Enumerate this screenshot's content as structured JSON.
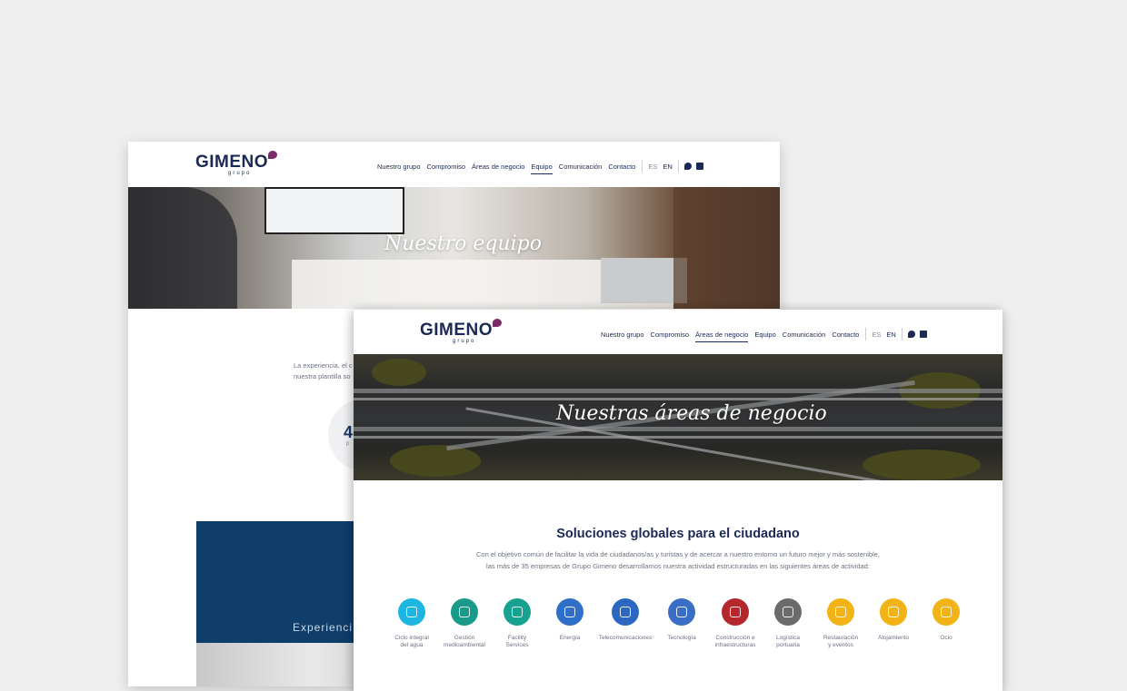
{
  "brand": {
    "logo_text": "GIMENO",
    "logo_sub": "grupo",
    "accent": "#1b2a55",
    "mark_color": "#7d2a6a"
  },
  "back_window": {
    "nav": [
      "Nuestro grupo",
      "Compromiso",
      "Áreas de negocio",
      "Equipo",
      "Comunicación",
      "Contacto"
    ],
    "active": "Equipo",
    "lang": [
      "ES",
      "EN"
    ],
    "hero_title": "Nuestro equipo",
    "text_line1": "La experiencia, el c",
    "text_line2": "nuestra plantilla so",
    "stat": "4",
    "stat_sub": "p",
    "block_label": "Experienci"
  },
  "front_window": {
    "nav": [
      "Nuestro grupo",
      "Compromiso",
      "Áreas de negocio",
      "Equipo",
      "Comunicación",
      "Contacto"
    ],
    "active": "Áreas de negocio",
    "lang": [
      "ES",
      "EN"
    ],
    "hero_title": "Nuestras áreas de negocio",
    "section_title": "Soluciones globales para el ciudadano",
    "desc_line1": "Con el objetivo común de facilitar la vida de ciudadanos/as y turistas y de acercar a nuestro entorno un futuro mejor y más sostenible,",
    "desc_line2": "las más de 35 empresas de Grupo Gimeno desarrollamos nuestra actividad estructuradas en las siguientes áreas de actividad:",
    "areas": [
      {
        "label1": "Ciclo integral",
        "label2": "del agua",
        "color": "#1cb6e0",
        "icon": "water-drop-icon"
      },
      {
        "label1": "Gestión",
        "label2": "medioambiental",
        "color": "#1a9b8a",
        "icon": "environment-icon"
      },
      {
        "label1": "Facility",
        "label2": "Services",
        "color": "#17a191",
        "icon": "facility-icon"
      },
      {
        "label1": "Energía",
        "label2": "",
        "color": "#2f6fc7",
        "icon": "energy-icon"
      },
      {
        "label1": "Telecomunicaciones",
        "label2": "",
        "color": "#2c68c0",
        "icon": "antenna-icon"
      },
      {
        "label1": "Tecnología",
        "label2": "",
        "color": "#3a6ec4",
        "icon": "technology-icon"
      },
      {
        "label1": "Construcción e",
        "label2": "infraestructuras",
        "color": "#b3272d",
        "icon": "crane-icon"
      },
      {
        "label1": "Logística",
        "label2": "portuaria",
        "color": "#6b6b6b",
        "icon": "port-icon"
      },
      {
        "label1": "Restauración",
        "label2": "y eventos",
        "color": "#f2b316",
        "icon": "restaurant-icon"
      },
      {
        "label1": "Alojamiento",
        "label2": "",
        "color": "#f2b316",
        "icon": "hotel-icon"
      },
      {
        "label1": "Ocio",
        "label2": "",
        "color": "#f2b316",
        "icon": "leisure-icon"
      }
    ]
  }
}
